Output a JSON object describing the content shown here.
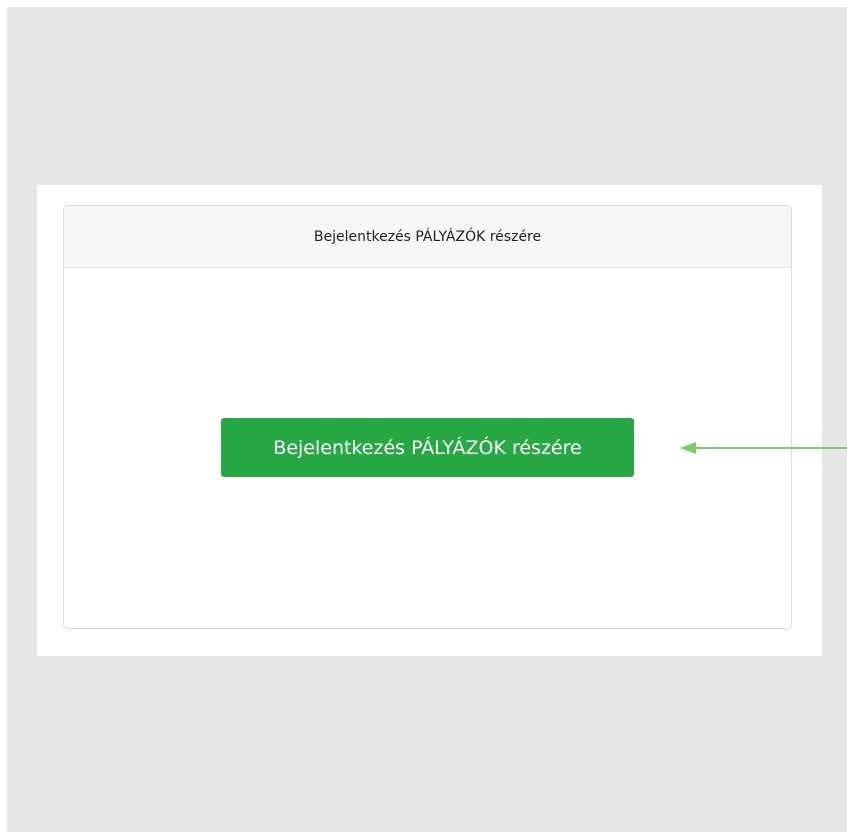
{
  "login_card": {
    "header_title": "Bejelentkezés PÁLYÁZÓK részére",
    "button_label": "Bejelentkezés PÁLYÁZÓK részére"
  },
  "colors": {
    "background": "#e6e7e9",
    "button": "#28a745",
    "arrow": "#7ccc6a"
  },
  "annotations": {
    "arrow_icon": "arrow-left-icon"
  }
}
